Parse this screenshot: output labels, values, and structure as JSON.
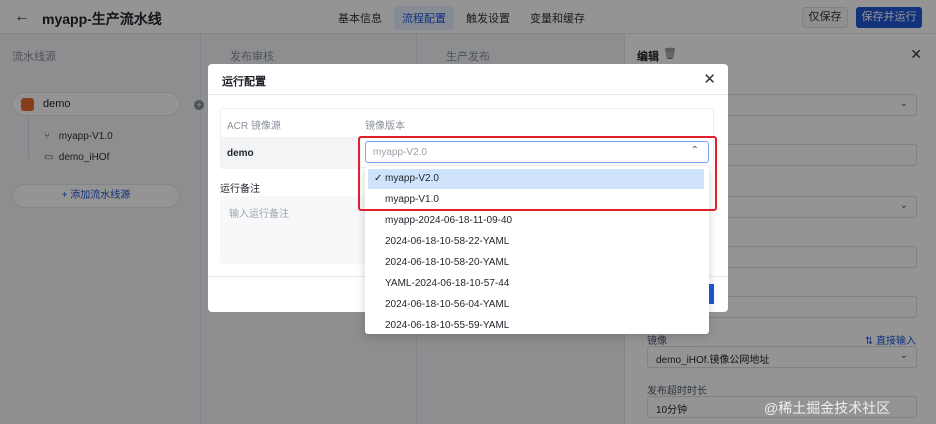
{
  "header": {
    "title": "myapp-生产流水线",
    "tabs": [
      "基本信息",
      "流程配置",
      "触发设置",
      "变量和缓存"
    ],
    "save_only": "仅保存",
    "save_run": "保存并运行"
  },
  "stages": {
    "source": "流水线源",
    "review": "发布审核",
    "deploy": "生产发布"
  },
  "source_card": {
    "name": "demo"
  },
  "source_items": [
    {
      "icon": "branch-icon",
      "label": "myapp-V1.0"
    },
    {
      "icon": "folder-icon",
      "label": "demo_iHOf"
    }
  ],
  "add_source": "+ 添加流水线源",
  "edit_panel": {
    "title": "编辑",
    "image_label": "镜像",
    "direct_input": "⇅ 直接输入",
    "image_value": "demo_iHOf.镜像公网地址",
    "timeout_label": "发布超时时长",
    "timeout_value": "10分钟"
  },
  "modal": {
    "title": "运行配置",
    "col_source": "ACR 镜像源",
    "col_version": "镜像版本",
    "row_name": "demo",
    "note_label": "运行备注",
    "note_placeholder": "输入运行备注",
    "select_placeholder": "myapp-V2.0",
    "options": [
      "myapp-V2.0",
      "myapp-V1.0",
      "myapp-2024-06-18-11-09-40",
      "2024-06-18-10-58-22-YAML",
      "2024-06-18-10-58-20-YAML",
      "YAML-2024-06-18-10-57-44",
      "2024-06-18-10-56-04-YAML",
      "2024-06-18-10-55-59-YAML"
    ],
    "selected": "myapp-V2.0"
  },
  "watermark": "@稀土掘金技术社区",
  "colors": {
    "accent": "#1f56d6",
    "highlight": "#e0202a"
  }
}
